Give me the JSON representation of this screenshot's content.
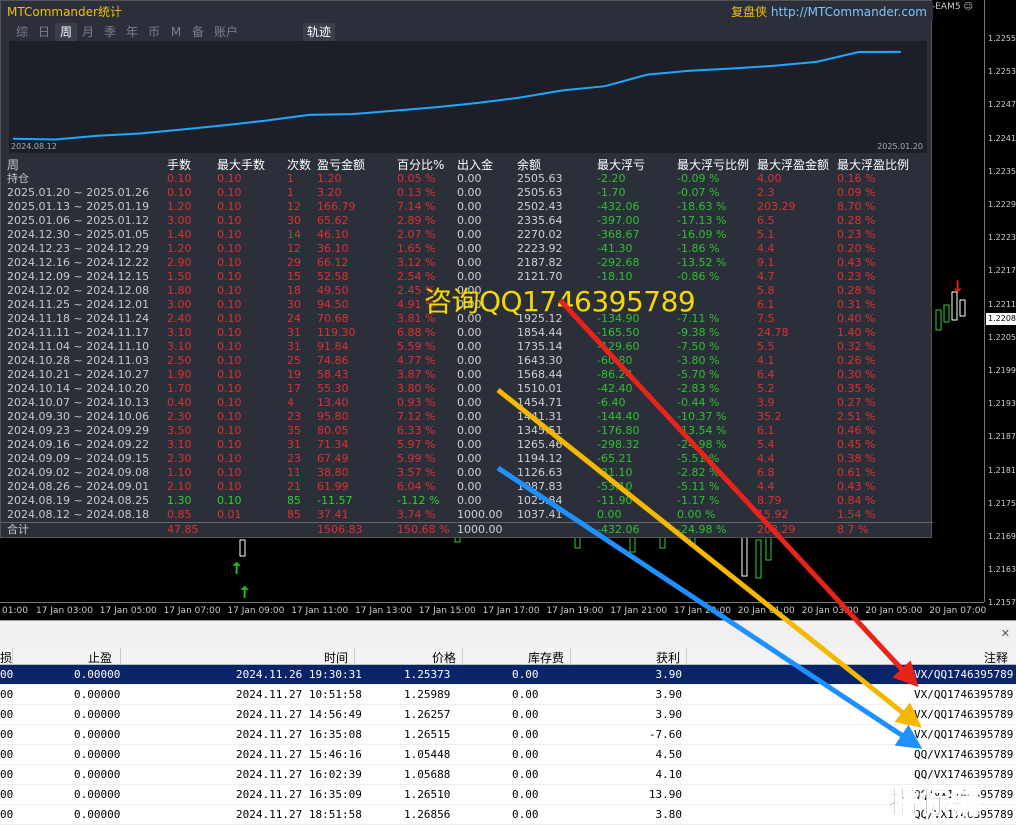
{
  "app": {
    "title": "MTCommander统计",
    "brand_prefix": "复盘侠",
    "brand_url": "http://MTCommander.com",
    "ea_label": "-EAM5 ☺"
  },
  "tabs": [
    "综",
    "日",
    "周",
    "月",
    "季",
    "年",
    "币",
    "M",
    "备",
    "账户"
  ],
  "selected_tab": "周",
  "track_tab": "轨迹",
  "mini_chart": {
    "start_date": "2024.08.12",
    "end_date": "2025.01.20",
    "color": "#1ea8ff"
  },
  "stats": {
    "headers": [
      "周",
      "手数",
      "最大手数",
      "次数",
      "盈亏金额",
      "百分比%",
      "出入金",
      "余额",
      "最大浮亏",
      "最大浮亏比例",
      "最大浮盈金额",
      "最大浮盈比例"
    ],
    "rows": [
      [
        "持仓",
        "0.10",
        "0.10",
        "1",
        "1.20",
        "0.05 %",
        "0.00",
        "2505.63",
        "-2.20",
        "-0.09 %",
        "4.00",
        "0.16 %"
      ],
      [
        "2025.01.20 ~ 2025.01.26",
        "0.10",
        "0.10",
        "1",
        "3.20",
        "0.13 %",
        "0.00",
        "2505.63",
        "-1.70",
        "-0.07 %",
        "2.3",
        "0.09 %"
      ],
      [
        "2025.01.13 ~ 2025.01.19",
        "1.20",
        "0.10",
        "12",
        "166.79",
        "7.14 %",
        "0.00",
        "2502.43",
        "-432.06",
        "-18.63 %",
        "203.29",
        "8.70 %"
      ],
      [
        "2025.01.06 ~ 2025.01.12",
        "3.00",
        "0.10",
        "30",
        "65.62",
        "2.89 %",
        "0.00",
        "2335.64",
        "-397.00",
        "-17.13 %",
        "6.5",
        "0.28 %"
      ],
      [
        "2024.12.30 ~ 2025.01.05",
        "1.40",
        "0.10",
        "14",
        "46.10",
        "2.07 %",
        "0.00",
        "2270.02",
        "-368.67",
        "-16.09 %",
        "5.1",
        "0.23 %"
      ],
      [
        "2024.12.23 ~ 2024.12.29",
        "1.20",
        "0.10",
        "12",
        "36.10",
        "1.65 %",
        "0.00",
        "2223.92",
        "-41.30",
        "-1.86 %",
        "4.4",
        "0.20 %"
      ],
      [
        "2024.12.16 ~ 2024.12.22",
        "2.90",
        "0.10",
        "29",
        "66.12",
        "3.12 %",
        "0.00",
        "2187.82",
        "-292.68",
        "-13.52 %",
        "9.1",
        "0.43 %"
      ],
      [
        "2024.12.09 ~ 2024.12.15",
        "1.50",
        "0.10",
        "15",
        "52.58",
        "2.54 %",
        "0.00",
        "2121.70",
        "-18.10",
        "-0.86 %",
        "4.7",
        "0.23 %"
      ],
      [
        "2024.12.02 ~ 2024.12.08",
        "1.80",
        "0.10",
        "18",
        "49.50",
        "2.45 %",
        "0.00",
        "",
        "",
        "",
        "5.8",
        "0.28 %"
      ],
      [
        "2024.11.25 ~ 2024.12.01",
        "3.00",
        "0.10",
        "30",
        "94.50",
        "4.91 %",
        "0.00",
        "",
        "",
        "",
        "6.1",
        "0.31 %"
      ],
      [
        "2024.11.18 ~ 2024.11.24",
        "2.40",
        "0.10",
        "24",
        "70.68",
        "3.81 %",
        "0.00",
        "1925.12",
        "-134.90",
        "-7.11 %",
        "7.5",
        "0.40 %"
      ],
      [
        "2024.11.11 ~ 2024.11.17",
        "3.10",
        "0.10",
        "31",
        "119.30",
        "6.88 %",
        "0.00",
        "1854.44",
        "-165.50",
        "-9.38 %",
        "24.78",
        "1.40 %"
      ],
      [
        "2024.11.04 ~ 2024.11.10",
        "3.10",
        "0.10",
        "31",
        "91.84",
        "5.59 %",
        "0.00",
        "1735.14",
        "-129.60",
        "-7.50 %",
        "5.5",
        "0.32 %"
      ],
      [
        "2024.10.28 ~ 2024.11.03",
        "2.50",
        "0.10",
        "25",
        "74.86",
        "4.77 %",
        "0.00",
        "1643.30",
        "-60.80",
        "-3.80 %",
        "4.1",
        "0.26 %"
      ],
      [
        "2024.10.21 ~ 2024.10.27",
        "1.90",
        "0.10",
        "19",
        "58.43",
        "3.87 %",
        "0.00",
        "1568.44",
        "-86.24",
        "-5.70 %",
        "6.4",
        "0.30 %"
      ],
      [
        "2024.10.14 ~ 2024.10.20",
        "1.70",
        "0.10",
        "17",
        "55.30",
        "3.80 %",
        "0.00",
        "1510.01",
        "-42.40",
        "-2.83 %",
        "5.2",
        "0.35 %"
      ],
      [
        "2024.10.07 ~ 2024.10.13",
        "0.40",
        "0.10",
        "4",
        "13.40",
        "0.93 %",
        "0.00",
        "1454.71",
        "-6.40",
        "-0.44 %",
        "3.9",
        "0.27 %"
      ],
      [
        "2024.09.30 ~ 2024.10.06",
        "2.30",
        "0.10",
        "23",
        "95.80",
        "7.12 %",
        "0.00",
        "1441.31",
        "-144.40",
        "-10.37 %",
        "35.2",
        "2.51 %"
      ],
      [
        "2024.09.23 ~ 2024.09.29",
        "3.50",
        "0.10",
        "35",
        "80.05",
        "6.33 %",
        "0.00",
        "1345.51",
        "-176.80",
        "-13.54 %",
        "6.1",
        "0.46 %"
      ],
      [
        "2024.09.16 ~ 2024.09.22",
        "3.10",
        "0.10",
        "31",
        "71.34",
        "5.97 %",
        "0.00",
        "1265.46",
        "-298.32",
        "-24.98 %",
        "5.4",
        "0.45 %"
      ],
      [
        "2024.09.09 ~ 2024.09.15",
        "2.30",
        "0.10",
        "23",
        "67.49",
        "5.99 %",
        "0.00",
        "1194.12",
        "-65.21",
        "-5.51 %",
        "4.4",
        "0.38 %"
      ],
      [
        "2024.09.02 ~ 2024.09.08",
        "1.10",
        "0.10",
        "11",
        "38.80",
        "3.57 %",
        "0.00",
        "1126.63",
        "-31.10",
        "-2.82 %",
        "6.8",
        "0.61 %"
      ],
      [
        "2024.08.26 ~ 2024.09.01",
        "2.10",
        "0.10",
        "21",
        "61.99",
        "6.04 %",
        "0.00",
        "1087.83",
        "-53.10",
        "-5.11 %",
        "4.4",
        "0.43 %"
      ],
      [
        "2024.08.19 ~ 2024.08.25",
        "1.30",
        "0.10",
        "85",
        "-11.57",
        "-1.12 %",
        "0.00",
        "1025.84",
        "-11.90",
        "-1.17 %",
        "8.79",
        "0.84 %"
      ],
      [
        "2024.08.12 ~ 2024.08.18",
        "0.85",
        "0.01",
        "85",
        "37.41",
        "3.74 %",
        "1000.00",
        "1037.41",
        "0.00",
        "0.00 %",
        "15.92",
        "1.54 %"
      ],
      [
        "合计",
        "47.85",
        "",
        "",
        "1506.83",
        "150.68 %",
        "1000.00",
        "",
        "-432.06",
        "-24.98 %",
        "203.29",
        "8.7 %"
      ]
    ]
  },
  "price_axis": [
    "1.2255",
    "1.2253",
    "1.2247",
    "1.2241",
    "1.2235",
    "1.2229",
    "1.2223",
    "1.2217",
    "1.2211",
    "1.2205",
    "1.2199",
    "1.2193",
    "1.2187",
    "1.2181",
    "1.2175",
    "1.2169",
    "1.2163",
    "1.2157"
  ],
  "current_price": "1.2208",
  "time_axis": [
    "01:00",
    "17 Jan 03:00",
    "17 Jan 05:00",
    "17 Jan 07:00",
    "17 Jan 09:00",
    "17 Jan 11:00",
    "17 Jan 13:00",
    "17 Jan 15:00",
    "17 Jan 17:00",
    "17 Jan 19:00",
    "17 Jan 21:00",
    "17 Jan 23:00",
    "20 Jan 01:00",
    "20 Jan 03:00",
    "20 Jan 05:00",
    "20 Jan 07:00"
  ],
  "ad_text": "咨询QQ1746395789",
  "trades": {
    "headers": [
      "损",
      "止盈",
      "时间",
      "价格",
      "库存费",
      "获利",
      "注释"
    ],
    "rows": [
      {
        "a": "00",
        "tp": "0.00000",
        "time": "2024.11.26 19:30:31",
        "price": "1.25373",
        "swap": "0.00",
        "profit": "3.90",
        "comment": "VX/QQ1746395789"
      },
      {
        "a": "00",
        "tp": "0.00000",
        "time": "2024.11.27 10:51:58",
        "price": "1.25989",
        "swap": "0.00",
        "profit": "3.90",
        "comment": "VX/QQ1746395789"
      },
      {
        "a": "00",
        "tp": "0.00000",
        "time": "2024.11.27 14:56:49",
        "price": "1.26257",
        "swap": "0.00",
        "profit": "3.90",
        "comment": "VX/QQ1746395789"
      },
      {
        "a": "00",
        "tp": "0.00000",
        "time": "2024.11.27 16:35:08",
        "price": "1.26515",
        "swap": "0.00",
        "profit": "-7.60",
        "comment": "VX/QQ1746395789"
      },
      {
        "a": "00",
        "tp": "0.00000",
        "time": "2024.11.27 15:46:16",
        "price": "1.05448",
        "swap": "0.00",
        "profit": "4.50",
        "comment": "QQ/VX1746395789"
      },
      {
        "a": "00",
        "tp": "0.00000",
        "time": "2024.11.27 16:02:39",
        "price": "1.05688",
        "swap": "0.00",
        "profit": "4.10",
        "comment": "QQ/VX1746395789"
      },
      {
        "a": "00",
        "tp": "0.00000",
        "time": "2024.11.27 16:35:09",
        "price": "1.26510",
        "swap": "0.00",
        "profit": "13.90",
        "comment": "QQ/VX1746395789"
      },
      {
        "a": "00",
        "tp": "0.00000",
        "time": "2024.11.27 18:51:58",
        "price": "1.26856",
        "swap": "0.00",
        "profit": "3.80",
        "comment": "QQ/VX1746395789"
      }
    ]
  },
  "watermark": "指标铺",
  "colors": {
    "loss": "#e03030",
    "gain": "#30d030",
    "panel": "#2b2f3a",
    "selected_row": "#0a246a",
    "arrow_red": "#e8241a",
    "arrow_orange": "#f5b800",
    "arrow_blue": "#1e90ff"
  }
}
